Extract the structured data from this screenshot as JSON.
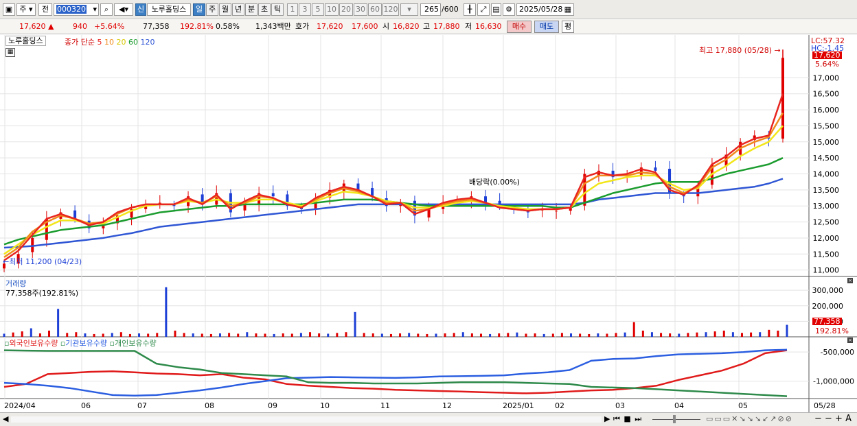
{
  "toolbar": {
    "type_label": "주",
    "prev_label": "전",
    "code": "000320",
    "new_badge": "신",
    "stock_name": "노루홀딩스",
    "period_tabs": [
      "일",
      "주",
      "월",
      "년",
      "분",
      "초",
      "틱"
    ],
    "interval_tabs": [
      "1",
      "3",
      "5",
      "10",
      "20",
      "30",
      "60",
      "120"
    ],
    "count_value": "265",
    "count_max": "/600",
    "date": "2025/05/28"
  },
  "quote": {
    "price": "17,620",
    "arrow": "▲",
    "change": "940",
    "change_pct": "+5.64%",
    "volume": "77,358",
    "volume_ratio": "192.81%",
    "turnover": "0.58%",
    "amount": "1,343백만",
    "bid_label": "호가",
    "ask_price": "17,620",
    "bid_price": "17,600",
    "open_label": "시",
    "open": "16,820",
    "high_label": "고",
    "high": "17,880",
    "low_label": "저",
    "low": "16,630",
    "buy_label": "매수",
    "sell_label": "매도",
    "avg_label": "평"
  },
  "colors": {
    "up": "#e00000",
    "down": "#1d3fd6",
    "ma5": "#e8251f",
    "ma10": "#f08a1c",
    "ma20": "#f2e61a",
    "ma60": "#1b9c2e",
    "ma120": "#2f56d4",
    "foreign": "#e01a1a",
    "institution": "#2b5ee0",
    "individual": "#2e8a4a"
  },
  "chart_data": [
    {
      "type": "line",
      "title": "노루홀딩스",
      "legend": {
        "price_label": "종가 단순",
        "periods": [
          "5",
          "10",
          "20",
          "60",
          "120"
        ],
        "placement": "top-left"
      },
      "x": [
        "2024/04",
        "06",
        "07",
        "08",
        "09",
        "10",
        "11",
        "12",
        "2025/01",
        "02",
        "03",
        "04",
        "05",
        "05/28"
      ],
      "y_ticks": [
        "11,000",
        "11,500",
        "12,000",
        "12,500",
        "13,000",
        "13,500",
        "14,000",
        "14,500",
        "15,000",
        "15,500",
        "16,000",
        "16,500",
        "17,000"
      ],
      "ylim": [
        10800,
        17950
      ],
      "series": [
        {
          "name": "종가",
          "values": [
            11200,
            11500,
            12000,
            12600,
            12800,
            12600,
            12300,
            12400,
            12700,
            12900,
            13000,
            13100,
            13000,
            13300,
            13100,
            13400,
            12800,
            13100,
            13400,
            13300,
            13000,
            12900,
            13200,
            13500,
            13700,
            13500,
            13300,
            13000,
            13100,
            12700,
            12900,
            13100,
            13200,
            13300,
            13100,
            13000,
            12900,
            12800,
            12900,
            12850,
            12950,
            14000,
            14100,
            13900,
            14000,
            14200,
            14100,
            13400,
            13300,
            13600,
            14300,
            14600,
            15000,
            15200,
            15100,
            17620
          ]
        },
        {
          "name": "5",
          "values": [
            11300,
            11600,
            12100,
            12600,
            12750,
            12600,
            12400,
            12500,
            12800,
            12950,
            13050,
            13050,
            13050,
            13250,
            13050,
            13350,
            12900,
            13150,
            13350,
            13250,
            13050,
            12950,
            13250,
            13450,
            13600,
            13500,
            13300,
            13050,
            13100,
            12750,
            12900,
            13100,
            13200,
            13250,
            13100,
            12950,
            12900,
            12850,
            12900,
            12900,
            12950,
            13900,
            14050,
            13950,
            14000,
            14150,
            14050,
            13500,
            13350,
            13650,
            14300,
            14550,
            14900,
            15100,
            15200,
            16500
          ]
        },
        {
          "name": "10",
          "values": [
            11400,
            11700,
            12200,
            12500,
            12700,
            12600,
            12450,
            12500,
            12750,
            12950,
            13050,
            13050,
            13050,
            13200,
            13100,
            13300,
            13000,
            13100,
            13300,
            13250,
            13050,
            12950,
            13200,
            13400,
            13550,
            13450,
            13300,
            13100,
            13100,
            12850,
            12900,
            13050,
            13150,
            13200,
            13100,
            12950,
            12900,
            12850,
            12900,
            12900,
            12950,
            13700,
            13950,
            13950,
            13950,
            14050,
            14000,
            13600,
            13400,
            13600,
            14200,
            14450,
            14800,
            15000,
            15150,
            15900
          ]
        },
        {
          "name": "20",
          "values": [
            11500,
            11800,
            12100,
            12350,
            12550,
            12550,
            12450,
            12450,
            12650,
            12850,
            13000,
            13050,
            13050,
            13150,
            13100,
            13200,
            13100,
            13100,
            13200,
            13200,
            13100,
            13000,
            13150,
            13300,
            13450,
            13400,
            13300,
            13150,
            13100,
            12950,
            12950,
            13000,
            13100,
            13150,
            13100,
            13000,
            12950,
            12900,
            12900,
            12900,
            12950,
            13400,
            13700,
            13800,
            13900,
            13950,
            13950,
            13700,
            13500,
            13550,
            14000,
            14250,
            14550,
            14800,
            15000,
            15500
          ]
        },
        {
          "name": "60",
          "values": [
            11800,
            11950,
            12050,
            12150,
            12250,
            12300,
            12350,
            12400,
            12500,
            12600,
            12700,
            12800,
            12850,
            12900,
            12950,
            13000,
            13000,
            13050,
            13050,
            13050,
            13050,
            13050,
            13100,
            13150,
            13200,
            13200,
            13200,
            13150,
            13100,
            13050,
            13000,
            13000,
            13000,
            13000,
            13000,
            13000,
            13000,
            13000,
            13000,
            12950,
            12950,
            13100,
            13250,
            13400,
            13500,
            13600,
            13700,
            13750,
            13750,
            13750,
            13850,
            14000,
            14100,
            14200,
            14300,
            14500
          ]
        },
        {
          "name": "120",
          "values": [
            11700,
            11720,
            11750,
            11800,
            11850,
            11900,
            11950,
            12000,
            12080,
            12150,
            12250,
            12350,
            12400,
            12450,
            12500,
            12550,
            12600,
            12650,
            12700,
            12750,
            12800,
            12850,
            12900,
            12950,
            13000,
            13050,
            13050,
            13050,
            13050,
            13050,
            13050,
            13050,
            13050,
            13050,
            13050,
            13050,
            13050,
            13050,
            13050,
            13050,
            13050,
            13100,
            13200,
            13250,
            13300,
            13350,
            13400,
            13400,
            13400,
            13400,
            13450,
            13500,
            13550,
            13600,
            13700,
            13850
          ]
        }
      ],
      "annotations": {
        "high": "최고 17,880 (05/28)",
        "low": "최저 11,200 (04/23)",
        "dividend": "배당락(0.00%)",
        "lc": "LC:57.32",
        "hc": "HC:-1.45",
        "last_price": "17,620",
        "last_pct": "5.64%"
      }
    },
    {
      "type": "bar",
      "title": "거래량",
      "current": "77,358주(192.81%)",
      "y_ticks": [
        "100,000",
        "200,000",
        "300,000"
      ],
      "ylim": [
        0,
        345000
      ],
      "values": [
        20000,
        28000,
        35000,
        55000,
        22000,
        40000,
        180000,
        25000,
        30000,
        22000,
        18000,
        20000,
        25000,
        30000,
        18000,
        22000,
        20000,
        25000,
        320000,
        40000,
        25000,
        22000,
        20000,
        18000,
        22000,
        25000,
        20000,
        30000,
        22000,
        20000,
        18000,
        22000,
        20000,
        25000,
        30000,
        22000,
        20000,
        25000,
        30000,
        160000,
        25000,
        22000,
        20000,
        18000,
        22000,
        25000,
        20000,
        18000,
        20000,
        22000,
        25000,
        30000,
        22000,
        20000,
        18000,
        22000,
        25000,
        28000,
        20000,
        22000,
        18000,
        20000,
        25000,
        22000,
        20000,
        18000,
        22000,
        20000,
        25000,
        28000,
        95000,
        40000,
        30000,
        25000,
        22000,
        20000,
        25000,
        28000,
        30000,
        35000,
        40000,
        30000,
        25000,
        28000,
        30000,
        45000,
        40000,
        77358
      ],
      "last_value": "77,358",
      "last_pct": "192.81%"
    },
    {
      "type": "line",
      "titles": [
        "외국인보유수량",
        "기관보유수량",
        "개인보유수량"
      ],
      "y_ticks": [
        "-500,000",
        "-1,000,000"
      ],
      "ylim": [
        -1300000,
        -380000
      ],
      "series": [
        {
          "name": "외국인보유수량",
          "values": [
            -1100000,
            -1050000,
            -880000,
            -860000,
            -840000,
            -830000,
            -850000,
            -870000,
            -880000,
            -900000,
            -880000,
            -940000,
            -970000,
            -1050000,
            -1080000,
            -1100000,
            -1120000,
            -1130000,
            -1150000,
            -1160000,
            -1170000,
            -1180000,
            -1190000,
            -1200000,
            -1210000,
            -1200000,
            -1180000,
            -1160000,
            -1150000,
            -1120000,
            -1080000,
            -980000,
            -900000,
            -820000,
            -700000,
            -520000,
            -470000
          ]
        },
        {
          "name": "기관보유수량",
          "values": [
            -1030000,
            -1050000,
            -1080000,
            -1120000,
            -1180000,
            -1240000,
            -1250000,
            -1240000,
            -1200000,
            -1160000,
            -1110000,
            -1050000,
            -1000000,
            -950000,
            -940000,
            -930000,
            -935000,
            -940000,
            -945000,
            -935000,
            -920000,
            -915000,
            -910000,
            -900000,
            -870000,
            -850000,
            -810000,
            -650000,
            -620000,
            -610000,
            -570000,
            -540000,
            -530000,
            -520000,
            -500000,
            -470000,
            -460000
          ]
        },
        {
          "name": "개인보유수량",
          "values": [
            -470000,
            -475000,
            -480000,
            -480000,
            -480000,
            -480000,
            -480000,
            -700000,
            -760000,
            -800000,
            -860000,
            -880000,
            -900000,
            -920000,
            -1020000,
            -1030000,
            -1030000,
            -1040000,
            -1040000,
            -1040000,
            -1030000,
            -1020000,
            -1020000,
            -1020000,
            -1030000,
            -1040000,
            -1050000,
            -1100000,
            -1110000,
            -1120000,
            -1140000,
            -1160000,
            -1180000,
            -1200000,
            -1220000,
            -1240000,
            -1260000
          ]
        }
      ]
    }
  ],
  "x_axis_labels": [
    "2024/04",
    "06",
    "07",
    "08",
    "09",
    "10",
    "11",
    "12",
    "2025/01",
    "02",
    "03",
    "04",
    "05",
    "05/28"
  ]
}
